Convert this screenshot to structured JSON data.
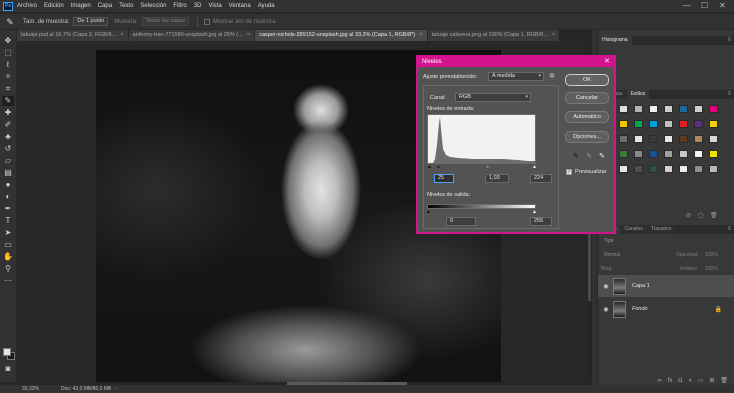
{
  "menubar": {
    "logo": "Ps",
    "items": [
      "Archivo",
      "Edición",
      "Imagen",
      "Capa",
      "Texto",
      "Selección",
      "Filtro",
      "3D",
      "Vista",
      "Ventana",
      "Ayuda"
    ],
    "minimize": "—",
    "maximize": "☐",
    "close": "✕"
  },
  "options": {
    "sample_size_label": "Tam. de muestra:",
    "sample_size_value": "De 1 punto",
    "sample_label": "Muestra:",
    "sample_value": "Todas las capas",
    "show_ring_label": "Mostrar aro de muestra"
  },
  "tabs": [
    {
      "label": "tatuaje.psd al 16,7% (Capa 2, RGB/8...",
      "active": false
    },
    {
      "label": "anthony-tran-771580-unsplash.jpg al 25% (...",
      "active": false
    },
    {
      "label": "casper-nichols-289152-unsplash.jpg al 33,3% (Capa 1, RGB/8*)",
      "active": true
    },
    {
      "label": "tatuaje calavera.png al 100% (Capa 1, RGB/8...",
      "active": false
    }
  ],
  "tab_close": "×",
  "statusbar": {
    "zoom": "33,33%",
    "doc": "Doc: 43,0 MB/86,0 MB"
  },
  "right_panel": {
    "histogram_tab": "Histograma",
    "swatches_tab": "Muestras",
    "styles_tab": "Estilos",
    "layers_tab": "Capas",
    "channels_tab": "Canales",
    "paths_tab": "Trazados",
    "kind_label": "Tipo",
    "blend_mode": "Normal",
    "opacity_label": "Opacidad:",
    "opacity_value": "100%",
    "lock_label": "Bloq.:",
    "fill_label": "Relleno:",
    "fill_value": "100%",
    "layers": [
      {
        "name": "Capa 1",
        "selected": true,
        "italic": false
      },
      {
        "name": "Fondo",
        "selected": false,
        "italic": true
      }
    ]
  },
  "levels_dialog": {
    "title": "Niveles",
    "preset_label": "Ajuste preestablecido:",
    "preset_value": "A medida",
    "channel_label": "Canal:",
    "channel_value": "RGB",
    "input_label": "Niveles de entrada:",
    "input_black": "25",
    "input_gamma": "1,03",
    "input_white": "224",
    "output_label": "Niveles de salida:",
    "output_black": "0",
    "output_white": "255",
    "ok": "OK",
    "cancel": "Cancelar",
    "auto": "Automático",
    "options": "Opciones...",
    "preview_label": "Previsualizar",
    "preview_checked": true
  },
  "colors": {
    "dialog_accent": "#d4148f",
    "selection_blue": "#4aa3ff",
    "ps_logo": "#31a8ff"
  }
}
